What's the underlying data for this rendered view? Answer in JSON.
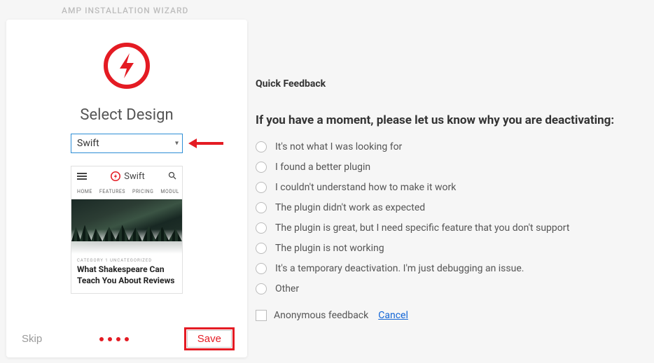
{
  "wizard_title": "AMP INSTALLATION WIZARD",
  "card": {
    "heading": "Select Design",
    "select_value": "Swift",
    "skip_label": "Skip",
    "save_label": "Save"
  },
  "preview": {
    "brand": "Swift",
    "nav": [
      "HOME",
      "FEATURES",
      "PRICING",
      "MODUL"
    ],
    "category": "CATEGORY 1  UNCATEGORIZED",
    "title": "What Shakespeare Can Teach You About Reviews"
  },
  "feedback": {
    "title": "Quick Feedback",
    "heading": "If you have a moment, please let us know why you are deactivating:",
    "options": [
      "It's not what I was looking for",
      "I found a better plugin",
      "I couldn't understand how to make it work",
      "The plugin didn't work as expected",
      "The plugin is great, but I need specific feature that you don't support",
      "The plugin is not working",
      "It's a temporary deactivation. I'm just debugging an issue.",
      "Other"
    ],
    "anonymous_label": "Anonymous feedback",
    "cancel_label": "Cancel"
  },
  "colors": {
    "accent": "#e41b23"
  }
}
